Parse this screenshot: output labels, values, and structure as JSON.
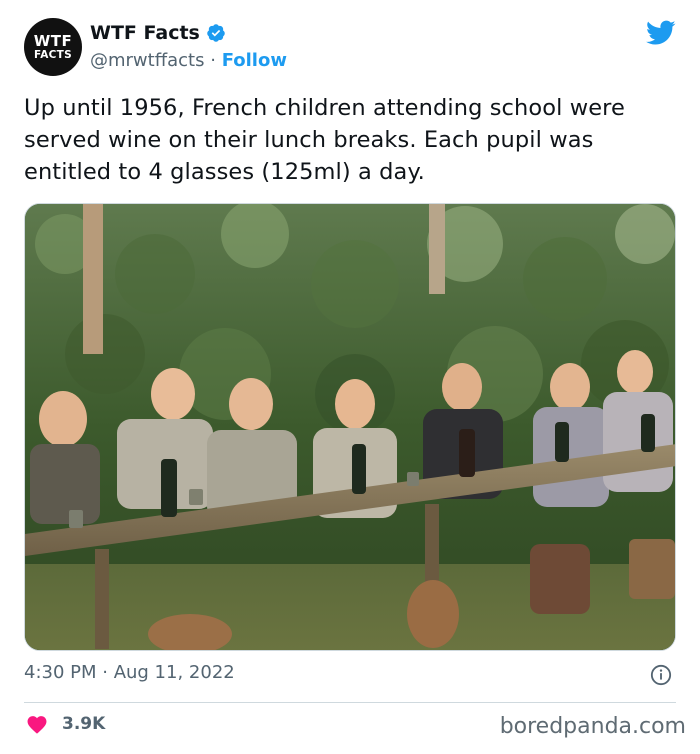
{
  "author": {
    "avatar_line1": "WTF",
    "avatar_line2": "FACTS",
    "display_name": "WTF Facts",
    "handle": "@mrwtffacts",
    "separator": "·",
    "follow_label": "Follow"
  },
  "tweet": {
    "text": "Up until 1956, French children attending school were served wine on their lunch breaks. Each pupil was entitled to 4 glasses (125ml) a day.",
    "timestamp": "4:30 PM · Aug 11, 2022",
    "like_count": "3.9K"
  },
  "icons": {
    "verified": "verified-badge-icon",
    "platform": "twitter-bird-icon",
    "info": "info-icon",
    "like": "heart-icon"
  },
  "colors": {
    "accent": "#1d9bf0",
    "like": "#f91880",
    "secondary_text": "#536471"
  },
  "watermark": "boredpanda.com"
}
